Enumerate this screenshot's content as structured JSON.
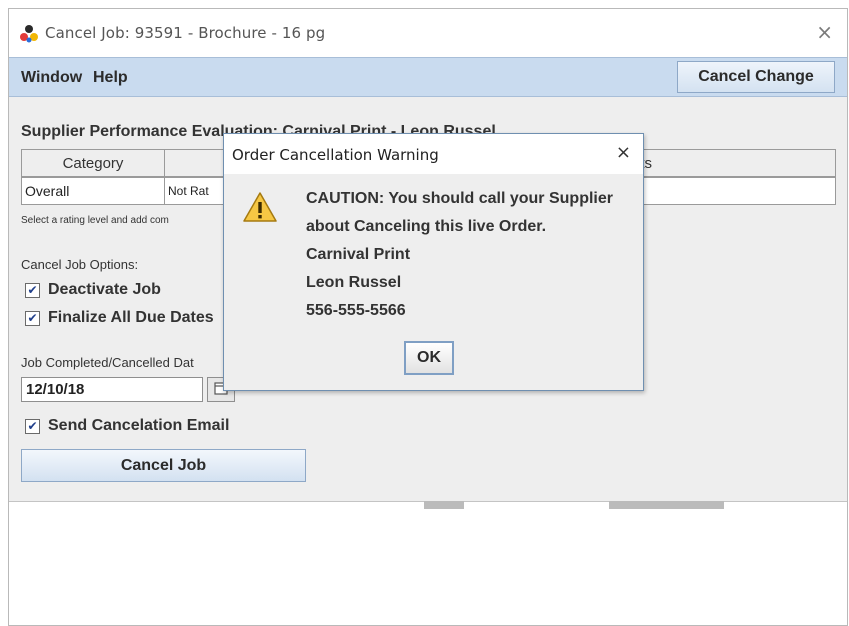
{
  "window": {
    "title": "Cancel Job: 93591 - Brochure - 16 pg",
    "close_glyph": "×",
    "app_icon": "colored-dots-icon"
  },
  "menubar": {
    "items": [
      "Window",
      "Help"
    ],
    "cancel_change_label": "Cancel Change"
  },
  "evaluation": {
    "title": "Supplier Performance Evaluation: Carnival Print - Leon Russel",
    "headers": [
      "Category",
      "",
      "nts"
    ],
    "row": [
      "Overall",
      "Not Rat",
      ""
    ],
    "hint": "Select a rating level and add com"
  },
  "cancel_options": {
    "label": "Cancel Job Options:",
    "deactivate_label": "Deactivate Job",
    "deactivate_checked": true,
    "finalize_label": "Finalize All Due Dates",
    "finalize_checked": true
  },
  "completion": {
    "date_label": "Job Completed/Cancelled Dat",
    "date_value": "12/10/18",
    "calendar_icon": "calendar-icon"
  },
  "email": {
    "label": "Send Cancelation Email",
    "checked": true
  },
  "check_glyph": "✔",
  "cancel_job_label": "Cancel Job",
  "dialog": {
    "title": "Order Cancellation Warning",
    "close_glyph": "×",
    "icon": "warning-icon",
    "lines": [
      "CAUTION: You should call your Supplier",
      "about Canceling this live Order.",
      "Carnival Print",
      "Leon Russel",
      "556-555-5566"
    ],
    "ok_label": "OK"
  },
  "colors": {
    "menubar_bg": "#c9dbef",
    "panel_bg": "#eeeeee",
    "warning_yellow": "#f6c744",
    "button_border": "#8ea8c7"
  }
}
